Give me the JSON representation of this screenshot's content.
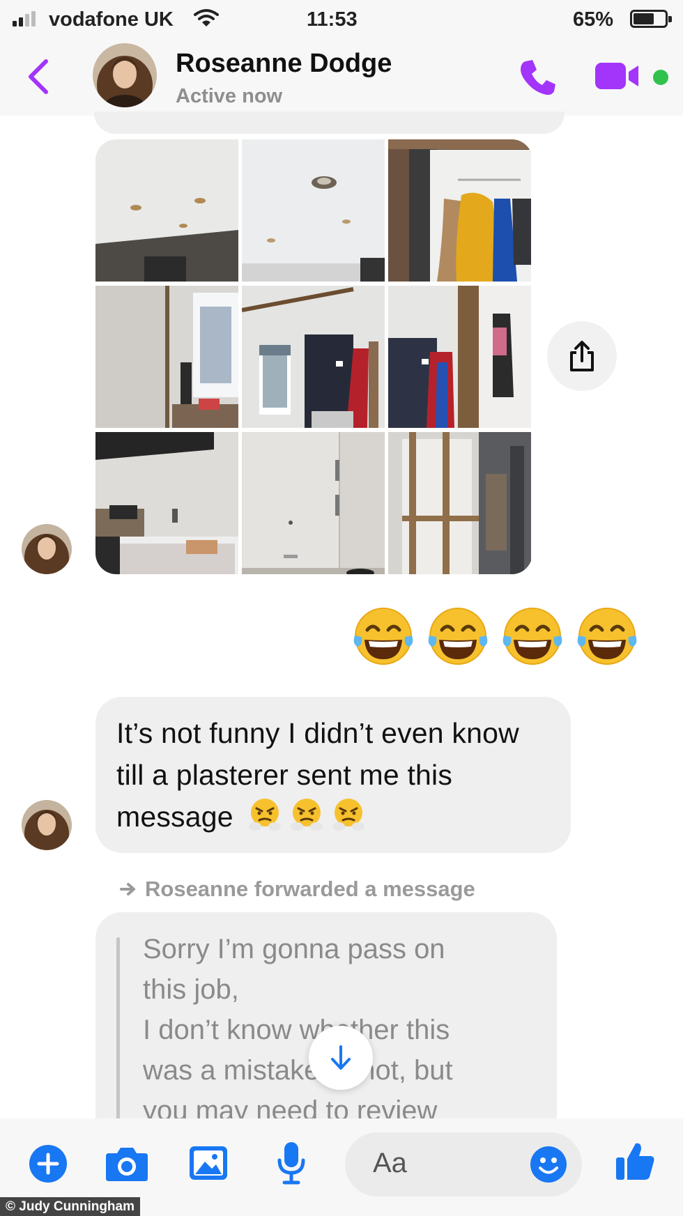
{
  "status_bar": {
    "carrier": "vodafone UK",
    "time": "11:53",
    "battery_percent": "65%",
    "battery_level": 0.65
  },
  "header": {
    "contact_name": "Roseanne Dodge",
    "status": "Active now"
  },
  "reaction_emojis": [
    "face-with-tears-of-joy",
    "face-with-tears-of-joy",
    "face-with-tears-of-joy",
    "face-with-tears-of-joy"
  ],
  "messages": {
    "incoming_text": "It’s not funny I didn’t even know till a plasterer sent me this message",
    "incoming_emojis": [
      "face-with-steam-from-nose",
      "face-with-steam-from-nose",
      "face-with-steam-from-nose"
    ],
    "forward_note": "Roseanne forwarded a message",
    "forwarded_lines": [
      "Sorry I’m gonna pass on",
      "this job,",
      "I don’t know whether this",
      "was a mistake or not, but",
      "you may need to review"
    ]
  },
  "composer": {
    "placeholder": "Aa"
  },
  "credit": "© Judy Cunningham",
  "colors": {
    "accent_purple": "#a334fa",
    "messenger_blue": "#1877f2",
    "active_green": "#31c24d"
  }
}
